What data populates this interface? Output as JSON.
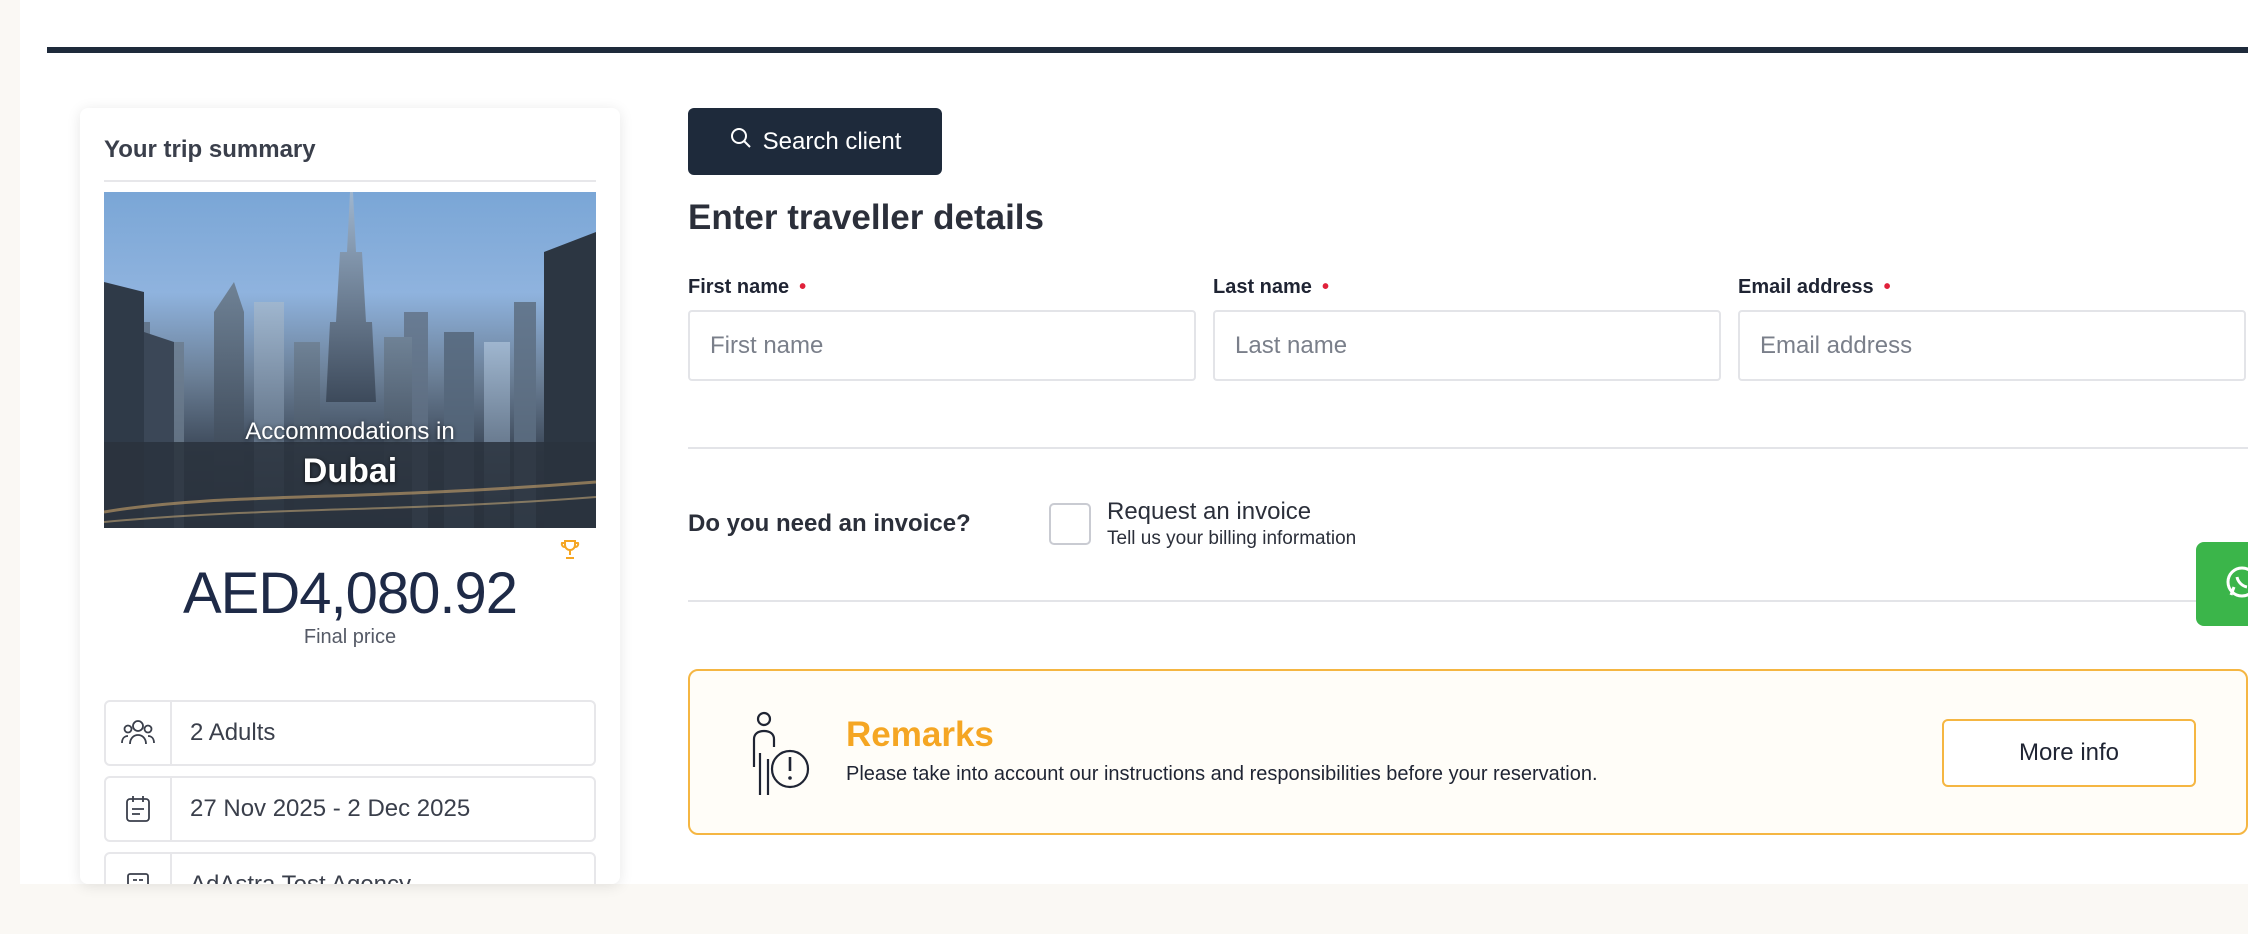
{
  "summary": {
    "title": "Your trip summary",
    "hero_subtitle": "Accommodations in",
    "hero_city": "Dubai",
    "price": "AED4,080.92",
    "price_label": "Final price",
    "rows": [
      {
        "icon": "users-icon",
        "text": "2 Adults"
      },
      {
        "icon": "calendar-icon",
        "text": "27 Nov 2025 - 2 Dec 2025"
      },
      {
        "icon": "building-icon",
        "text": "AdAstra Test Agency"
      }
    ]
  },
  "search_button": {
    "label": "Search client",
    "icon": "search-icon"
  },
  "form": {
    "title": "Enter traveller details",
    "first_name": {
      "label": "First name",
      "placeholder": "First name"
    },
    "last_name": {
      "label": "Last name",
      "placeholder": "Last name"
    },
    "email": {
      "label": "Email address",
      "placeholder": "Email address"
    },
    "required_mark": "•"
  },
  "invoice": {
    "question": "Do you need an invoice?",
    "option_title": "Request an invoice",
    "option_subtitle": "Tell us your billing information",
    "checked": false
  },
  "remarks": {
    "title": "Remarks",
    "text": "Please take into account our instructions and responsibilities before your reservation.",
    "button": "More info"
  },
  "colors": {
    "navy": "#1e2a3b",
    "accent_orange": "#f5a623",
    "required_red": "#e0213a",
    "whatsapp_green": "#3bb54a"
  }
}
